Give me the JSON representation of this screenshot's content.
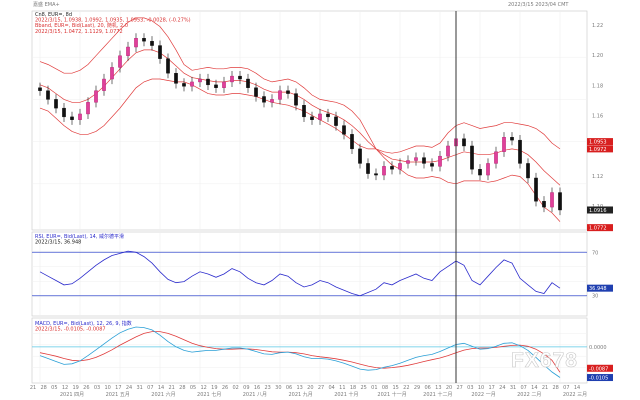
{
  "app": {
    "title_left": "嘉盛 EMA+",
    "title_right": "2022/3/15 2023/04 CMT"
  },
  "watermark": "FX678",
  "price_panel": {
    "header": [
      {
        "text": "Cn8, EUR=, 8d",
        "color": "#222222"
      },
      {
        "text": "2022/3/15, 1.0938, 1.0992, 1.0935, 1.0953, -0.0028, (-0.27%)",
        "color": "#d93030"
      },
      {
        "text": "Bband, EUR=, Bid(Last), 20, 随机, 2.0",
        "color": "#d93030"
      },
      {
        "text": "2022/3/15, 1.0472, 1.1129, 1.0772",
        "color": "#d93030"
      }
    ],
    "y_ticks": [
      "1.22",
      "1.20",
      "1.18",
      "1.16",
      "1.14",
      "1.12",
      "1.10"
    ],
    "price_badges": [
      {
        "text": "1.0953",
        "bg": "#d81f1f",
        "fg": "#ffffff"
      },
      {
        "text": "1.0972",
        "bg": "#d81f1f",
        "fg": "#ffffff"
      },
      {
        "text": "1.0916",
        "bg": "#222222",
        "fg": "#ffffff"
      },
      {
        "text": "1.0772",
        "bg": "#d81f1f",
        "fg": "#ffffff"
      }
    ]
  },
  "rsi_panel": {
    "header": [
      {
        "text": "RSI, EUR=, Bid(Last), 14, 威尔德平滑",
        "color": "#2b2bcc"
      },
      {
        "text": "2022/3/15, 36.948",
        "color": "#222222"
      }
    ],
    "y_ticks": [
      "70",
      "30"
    ],
    "badge": {
      "text": "36.948",
      "bg": "#1f3fb0",
      "fg": "#ffffff"
    }
  },
  "macd_panel": {
    "header": [
      {
        "text": "MACD, EUR=, Bid(Last), 12, 26, 9, 指数",
        "color": "#2b2bcc"
      },
      {
        "text": "2022/3/15, -0.0105, -0.0087",
        "color": "#d93030"
      }
    ],
    "y_ticks": [
      "0.0000"
    ],
    "badges": [
      {
        "text": "-0.0087",
        "bg": "#d81f1f",
        "fg": "#ffffff"
      },
      {
        "text": "-0.0105",
        "bg": "#1f3fb0",
        "fg": "#ffffff"
      }
    ]
  },
  "x_axis": {
    "day_ticks": [
      "21",
      "28",
      "05",
      "12",
      "19",
      "26",
      "03",
      "10",
      "17",
      "24",
      "31",
      "07",
      "14",
      "21",
      "28",
      "05",
      "12",
      "19",
      "26",
      "02",
      "09",
      "16",
      "23",
      "30",
      "06",
      "13",
      "20",
      "27",
      "04",
      "11",
      "18",
      "25",
      "01",
      "08",
      "15",
      "22",
      "29",
      "06",
      "13",
      "20",
      "27",
      "03",
      "10",
      "17",
      "24",
      "31",
      "07",
      "14",
      "21",
      "28",
      "07",
      "14"
    ],
    "month_labels": [
      "2021 四月",
      "2021 五月",
      "2021 六月",
      "2021 七月",
      "2021 八月",
      "2021 九月",
      "2021 十月",
      "2021 十一月",
      "2021 十二月",
      "2022 一月",
      "2022 二月",
      "2022 三月"
    ]
  },
  "chart_data": [
    {
      "type": "candlestick",
      "title": "",
      "series": [
        {
          "name": "EUR= daily close",
          "color": "#000000",
          "values": [
            1.178,
            1.172,
            1.166,
            1.16,
            1.158,
            1.162,
            1.17,
            1.178,
            1.186,
            1.194,
            1.202,
            1.208,
            1.214,
            1.212,
            1.209,
            1.2,
            1.19,
            1.183,
            1.181,
            1.184,
            1.186,
            1.182,
            1.18,
            1.184,
            1.188,
            1.186,
            1.18,
            1.174,
            1.17,
            1.172,
            1.178,
            1.176,
            1.168,
            1.16,
            1.158,
            1.162,
            1.16,
            1.154,
            1.148,
            1.138,
            1.128,
            1.121,
            1.12,
            1.126,
            1.124,
            1.128,
            1.13,
            1.132,
            1.128,
            1.126,
            1.133,
            1.14,
            1.145,
            1.14,
            1.124,
            1.12,
            1.128,
            1.136,
            1.146,
            1.144,
            1.128,
            1.118,
            1.102,
            1.098,
            1.108,
            1.096
          ]
        },
        {
          "name": "Bollinger upper",
          "color": "#e03c3c",
          "values": [
            1.198,
            1.196,
            1.193,
            1.19,
            1.19,
            1.192,
            1.196,
            1.202,
            1.208,
            1.214,
            1.22,
            1.225,
            1.228,
            1.228,
            1.226,
            1.222,
            1.215,
            1.206,
            1.196,
            1.192,
            1.193,
            1.194,
            1.193,
            1.193,
            1.194,
            1.194,
            1.193,
            1.19,
            1.186,
            1.184,
            1.185,
            1.186,
            1.184,
            1.18,
            1.175,
            1.172,
            1.171,
            1.17,
            1.168,
            1.164,
            1.158,
            1.148,
            1.138,
            1.136,
            1.135,
            1.136,
            1.138,
            1.14,
            1.14,
            1.139,
            1.142,
            1.149,
            1.154,
            1.156,
            1.154,
            1.152,
            1.153,
            1.154,
            1.156,
            1.156,
            1.155,
            1.154,
            1.152,
            1.148,
            1.142,
            1.138
          ]
        },
        {
          "name": "Bollinger middle",
          "color": "#e03c3c",
          "values": [
            1.182,
            1.18,
            1.176,
            1.172,
            1.17,
            1.17,
            1.172,
            1.176,
            1.181,
            1.187,
            1.193,
            1.199,
            1.204,
            1.206,
            1.206,
            1.204,
            1.2,
            1.195,
            1.19,
            1.187,
            1.186,
            1.185,
            1.184,
            1.184,
            1.185,
            1.185,
            1.184,
            1.182,
            1.179,
            1.177,
            1.177,
            1.177,
            1.175,
            1.172,
            1.168,
            1.165,
            1.163,
            1.161,
            1.158,
            1.154,
            1.149,
            1.143,
            1.138,
            1.134,
            1.131,
            1.13,
            1.129,
            1.129,
            1.129,
            1.129,
            1.13,
            1.132,
            1.134,
            1.136,
            1.135,
            1.134,
            1.134,
            1.135,
            1.137,
            1.138,
            1.137,
            1.134,
            1.129,
            1.123,
            1.118,
            1.113
          ]
        },
        {
          "name": "Bollinger lower",
          "color": "#e03c3c",
          "values": [
            1.166,
            1.164,
            1.159,
            1.154,
            1.15,
            1.148,
            1.148,
            1.15,
            1.154,
            1.16,
            1.166,
            1.173,
            1.18,
            1.184,
            1.186,
            1.186,
            1.185,
            1.184,
            1.184,
            1.182,
            1.179,
            1.176,
            1.175,
            1.175,
            1.176,
            1.176,
            1.175,
            1.174,
            1.172,
            1.17,
            1.169,
            1.168,
            1.166,
            1.164,
            1.161,
            1.158,
            1.155,
            1.152,
            1.148,
            1.144,
            1.14,
            1.138,
            1.138,
            1.132,
            1.127,
            1.124,
            1.12,
            1.118,
            1.118,
            1.119,
            1.118,
            1.115,
            1.114,
            1.116,
            1.116,
            1.116,
            1.115,
            1.116,
            1.118,
            1.12,
            1.119,
            1.114,
            1.106,
            1.098,
            1.094,
            1.088
          ]
        }
      ],
      "y_range": [
        1.085,
        1.23
      ]
    },
    {
      "type": "line",
      "title": "",
      "series": [
        {
          "name": "RSI 14",
          "color": "#2b2bcc",
          "values": [
            52,
            48,
            44,
            40,
            41,
            46,
            52,
            58,
            63,
            67,
            69,
            71,
            70,
            66,
            60,
            52,
            45,
            42,
            43,
            48,
            52,
            50,
            47,
            50,
            55,
            52,
            46,
            42,
            40,
            44,
            50,
            48,
            42,
            38,
            40,
            44,
            42,
            38,
            35,
            32,
            30,
            33,
            36,
            42,
            40,
            44,
            47,
            50,
            46,
            44,
            52,
            57,
            62,
            58,
            44,
            40,
            48,
            56,
            63,
            60,
            46,
            40,
            34,
            32,
            42,
            36.948
          ]
        }
      ],
      "y_range": [
        15,
        85
      ],
      "reference_lines": [
        70,
        30
      ]
    },
    {
      "type": "line",
      "title": "",
      "series": [
        {
          "name": "MACD line",
          "color": "#2a9fd6",
          "values": [
            -0.003,
            -0.004,
            -0.005,
            -0.006,
            -0.0058,
            -0.0048,
            -0.003,
            -0.001,
            0.001,
            0.003,
            0.0048,
            0.006,
            0.0068,
            0.0066,
            0.0058,
            0.004,
            0.0018,
            0.0,
            -0.0012,
            -0.0018,
            -0.0015,
            -0.0012,
            -0.0012,
            -0.0008,
            -0.0004,
            -0.0004,
            -0.0008,
            -0.0016,
            -0.0024,
            -0.0026,
            -0.002,
            -0.0018,
            -0.0024,
            -0.0034,
            -0.004,
            -0.004,
            -0.0042,
            -0.0048,
            -0.0056,
            -0.0066,
            -0.0076,
            -0.008,
            -0.0078,
            -0.007,
            -0.0064,
            -0.0056,
            -0.0046,
            -0.0036,
            -0.003,
            -0.0026,
            -0.0016,
            -0.0004,
            0.0008,
            0.0012,
            0.0002,
            -0.0008,
            -0.0006,
            0.0002,
            0.0012,
            0.0014,
            0.0004,
            -0.0012,
            -0.0036,
            -0.0062,
            -0.0086,
            -0.0105
          ]
        },
        {
          "name": "Signal line",
          "color": "#e03c3c",
          "values": [
            -0.002,
            -0.0026,
            -0.0032,
            -0.004,
            -0.0046,
            -0.0048,
            -0.0044,
            -0.0036,
            -0.0024,
            -0.001,
            0.0006,
            0.002,
            0.0034,
            0.0046,
            0.0052,
            0.0052,
            0.0046,
            0.0036,
            0.0024,
            0.0012,
            0.0004,
            -0.0002,
            -0.0006,
            -0.0008,
            -0.0008,
            -0.0007,
            -0.0007,
            -0.0009,
            -0.0013,
            -0.0017,
            -0.0018,
            -0.0018,
            -0.002,
            -0.0024,
            -0.003,
            -0.0034,
            -0.0037,
            -0.0041,
            -0.0046,
            -0.0052,
            -0.0059,
            -0.0066,
            -0.0071,
            -0.0073,
            -0.0071,
            -0.0068,
            -0.0063,
            -0.0057,
            -0.005,
            -0.0044,
            -0.0038,
            -0.003,
            -0.002,
            -0.0011,
            -0.0006,
            -0.0004,
            -0.0004,
            -0.0002,
            0.0002,
            0.0005,
            0.0006,
            0.0002,
            -0.0008,
            -0.0024,
            -0.0046,
            -0.0087
          ]
        }
      ],
      "y_range": [
        -0.011,
        0.0085
      ],
      "reference_lines": [
        0.0
      ]
    }
  ]
}
